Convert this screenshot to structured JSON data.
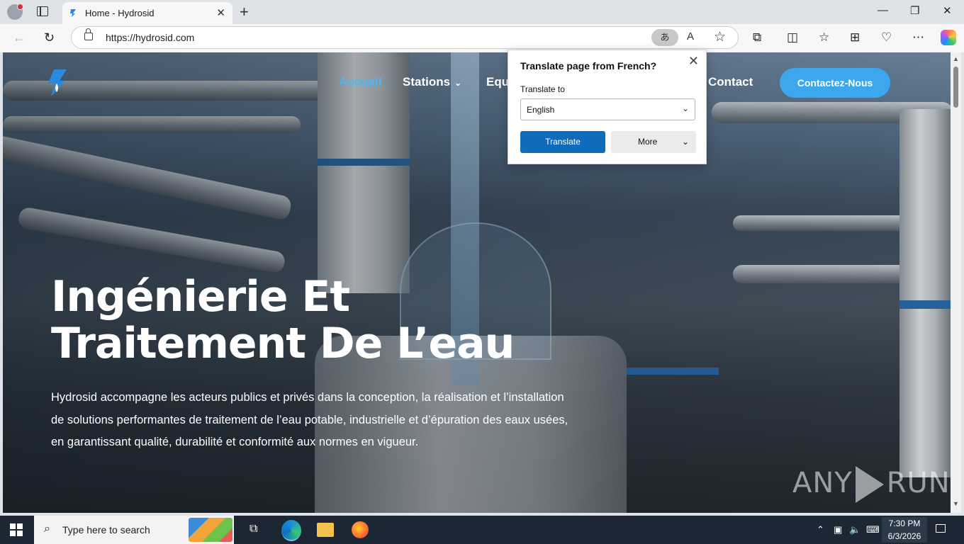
{
  "browser": {
    "tab_title": "Home - Hydrosid",
    "tab_close": "✕",
    "new_tab": "+",
    "window_controls": {
      "minimize": "—",
      "restore": "❐",
      "close": "✕"
    },
    "url": "https://hydrosid.com",
    "translate_chip": "あ",
    "read_aloud": "A",
    "favorite": "☆"
  },
  "site": {
    "nav": [
      {
        "label": "Accueil",
        "active": true
      },
      {
        "label": "Stations",
        "has_dropdown": true
      },
      {
        "label": "Equ"
      },
      {
        "label": "Contact"
      }
    ],
    "cta_label": "Contactez-Nous",
    "hero_title_line1": "Ingénierie Et",
    "hero_title_line2": "Traitement De L’eau",
    "hero_text": "Hydrosid accompagne les acteurs publics et privés dans la conception, la réalisation et l’installation de solutions performantes de traitement de l’eau potable, industrielle et d’épuration des eaux usées, en garantissant qualité, durabilité et conformité aux normes en vigueur.",
    "watermark_left": "ANY",
    "watermark_right": "RUN",
    "accent_color": "#3aa7ee"
  },
  "translate_popup": {
    "title": "Translate page from French?",
    "translate_to_label": "Translate to",
    "language": "English",
    "translate_button": "Translate",
    "more_button": "More"
  },
  "taskbar": {
    "search_placeholder": "Type here to search",
    "time": "7:30 PM",
    "date": "6/3/2026"
  }
}
